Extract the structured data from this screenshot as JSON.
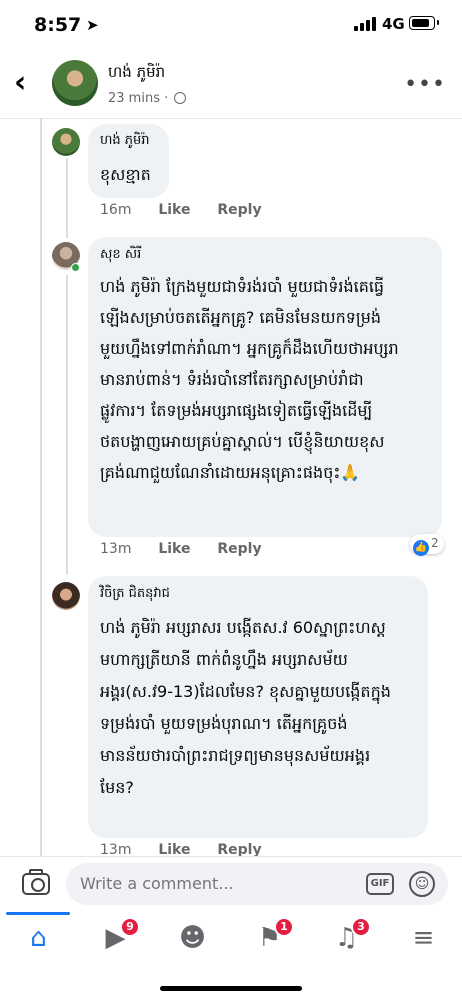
{
  "status_bar": {
    "time": "8:57",
    "network": "4G"
  },
  "post_header": {
    "name": "ហង់ ភូមិរ៉ា",
    "time": "23 mins ·"
  },
  "comments": [
    {
      "author": "ហង់ ភូមិរ៉ា",
      "lines": [
        "ខុសខ្មាត"
      ],
      "time": "16m",
      "like": "Like",
      "reply": "Reply"
    },
    {
      "author": "សុខ សិរី",
      "lines": [
        "ហង់ ភូមិរ៉ា ក្រែងមួយជាទំរង់របាំ មួយជាទំរង់គេធ្វើ",
        "ឡើងសម្រាប់ចតតើអ្នកគ្រូ? គេមិនមែនយកទម្រង់",
        "មួយហ្នឹងទៅពាក់រាំណា។ អ្នកគ្រូក៏ដឹងហើយថាអប្សរា",
        "មានរាប់ពាន់។ ទំរង់របាំនៅតែរក្សាសម្រាប់រាំជា",
        "ផ្លូវការ។ តែទម្រង់អប្សរាផ្សេងទៀតធ្វើឡើងដើម្បី",
        "ថតបង្ហាញអោយគ្រប់គ្នាស្គាល់។ បើខ្ញុំនិយាយខុស",
        "គ្រង់ណាជួយណែនាំដោយអនុគ្រោះផងចុះ🙏"
      ],
      "time": "13m",
      "like": "Like",
      "reply": "Reply",
      "reactions": "2"
    },
    {
      "author": "វិចិត្រ ជិតនុវាជ",
      "lines": [
        "ហង់ ភូមិរ៉ា អប្សរាសរ បង្កើតស.វ 60ស្នាព្រះហស្ត",
        "មហាក្សត្រីយានី ពាក់ពំនូហ្នឹង អប្សរាសម័យ",
        "អង្គរ(ស.វ9-13)ដែលមែន? ខុសគ្នាមួយបង្កើតក្នុង",
        "ទម្រង់របាំ មួយទម្រង់បុរាណ។ តើអ្នកគ្រូចង់",
        "មានន័យថារបាំព្រះរាជទ្រព្យមានមុនសម័យអង្គរ",
        "មែន?"
      ],
      "time": "13m",
      "like": "Like",
      "reply": "Reply"
    }
  ],
  "composer": {
    "placeholder": "Write a comment...",
    "gif_label": "GIF"
  },
  "tabs": [
    {
      "icon": "home-icon",
      "badge": ""
    },
    {
      "icon": "watch-icon",
      "badge": "9"
    },
    {
      "icon": "groups-icon",
      "badge": ""
    },
    {
      "icon": "pages-flag-icon",
      "badge": "1"
    },
    {
      "icon": "notifications-bell-icon",
      "badge": "3"
    },
    {
      "icon": "menu-icon",
      "badge": ""
    }
  ],
  "colors": {
    "accent": "#1877f2",
    "bubble": "#eff2f5",
    "badge": "#e41e3f",
    "meta": "#65676b"
  }
}
